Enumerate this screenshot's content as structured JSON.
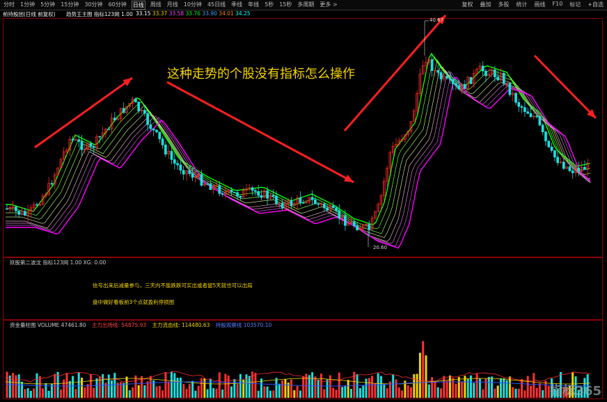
{
  "toolbar": {
    "tabs": [
      "分时",
      "1分钟",
      "5分钟",
      "15分钟",
      "30分钟",
      "60分钟",
      "日线",
      "周线",
      "月线",
      "10分钟",
      "45日线",
      "季线",
      "年线",
      "5秒",
      "15秒",
      "多周期",
      "更多 >"
    ],
    "active_tab": "日线",
    "right_items": [
      "复权",
      "叠加",
      "多股",
      "统计",
      "画线",
      "F10",
      "标记",
      "+自选"
    ]
  },
  "title_bar": {
    "stock": "前持股团(日线 前复权)",
    "indicator": "趋势王主图 指标123网 1.00",
    "values": [
      "33.15",
      "33.37",
      "33.58",
      "33.76",
      "33.90",
      "34.01",
      "34.25"
    ]
  },
  "annotation": "这种走势的个股没有指标怎么操作",
  "price_labels": {
    "high": "40.67",
    "low": "20.60"
  },
  "sub1": {
    "title": "妖股第二波沈 指标123网 1.00 XG: 0.00",
    "msg1": "信号出来后减量参与，三天内不能跌跌可买出或者留5天就也可以出局",
    "msg2": "盘中做好看板前3个点就盈利停损图"
  },
  "sub2": {
    "title": "资金量柱图 VOLUME 47461.80",
    "main_out": "主力出场线: 54875.93",
    "main_in": "主力流血线: 114480.63",
    "extra": "持股观察线 103570.10"
  },
  "watermark": "指标365",
  "colors": {
    "up": "#ff2a2a",
    "down": "#18e0e0",
    "green": "#00ff00",
    "magenta": "#ff00ff",
    "yellow": "#f2d300",
    "axis": "#8b0000"
  }
}
